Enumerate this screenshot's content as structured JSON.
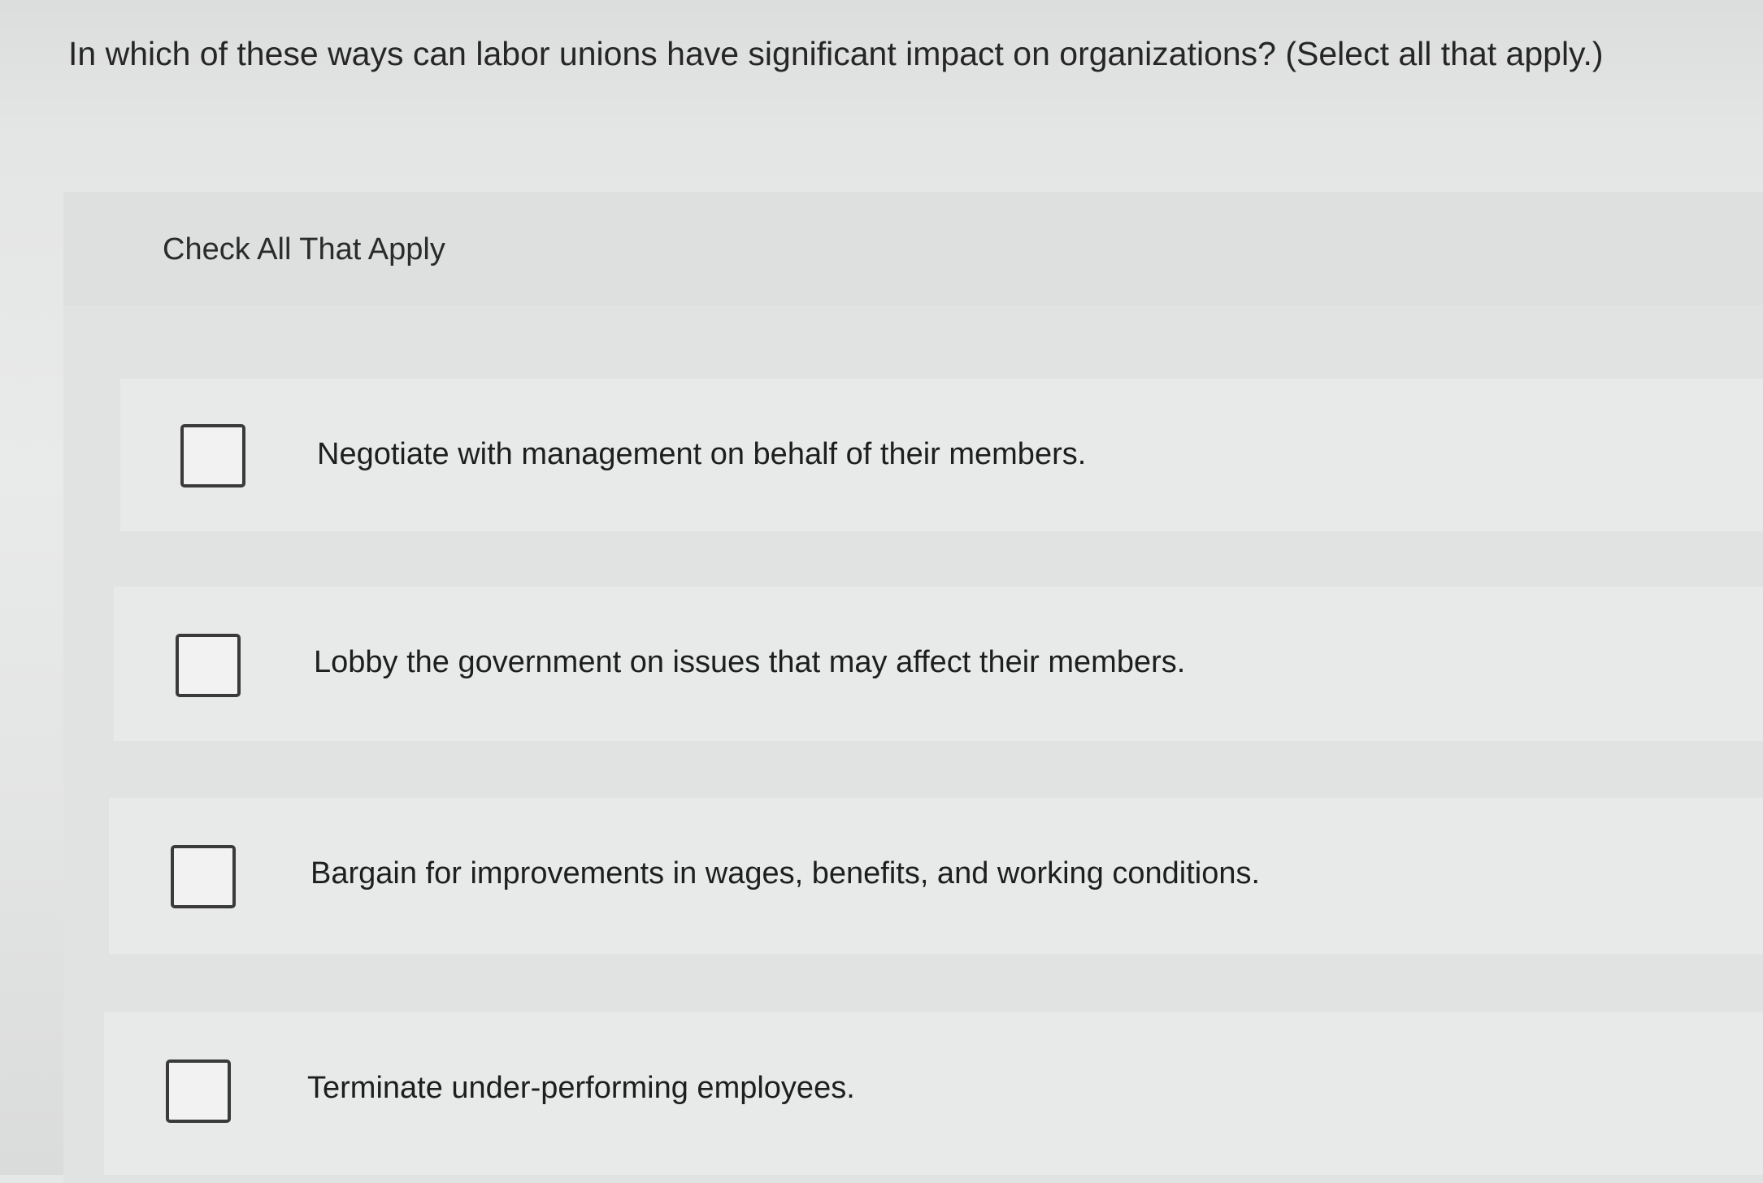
{
  "question": {
    "text": "In which of these ways can labor unions have significant impact on organizations? (Select all that apply.)"
  },
  "panel": {
    "header_label": "Check All That Apply"
  },
  "options": [
    {
      "label": "Negotiate with management on behalf of their members.",
      "checked": false
    },
    {
      "label": "Lobby the government on issues that may affect their members.",
      "checked": false
    },
    {
      "label": "Bargain for improvements in wages, benefits, and working conditions.",
      "checked": false
    },
    {
      "label": "Terminate under-performing employees.",
      "checked": false
    }
  ],
  "colors": {
    "text": "#1e1e1e",
    "checkbox_border": "#3a3a3a",
    "background": "#e6e7e7"
  }
}
